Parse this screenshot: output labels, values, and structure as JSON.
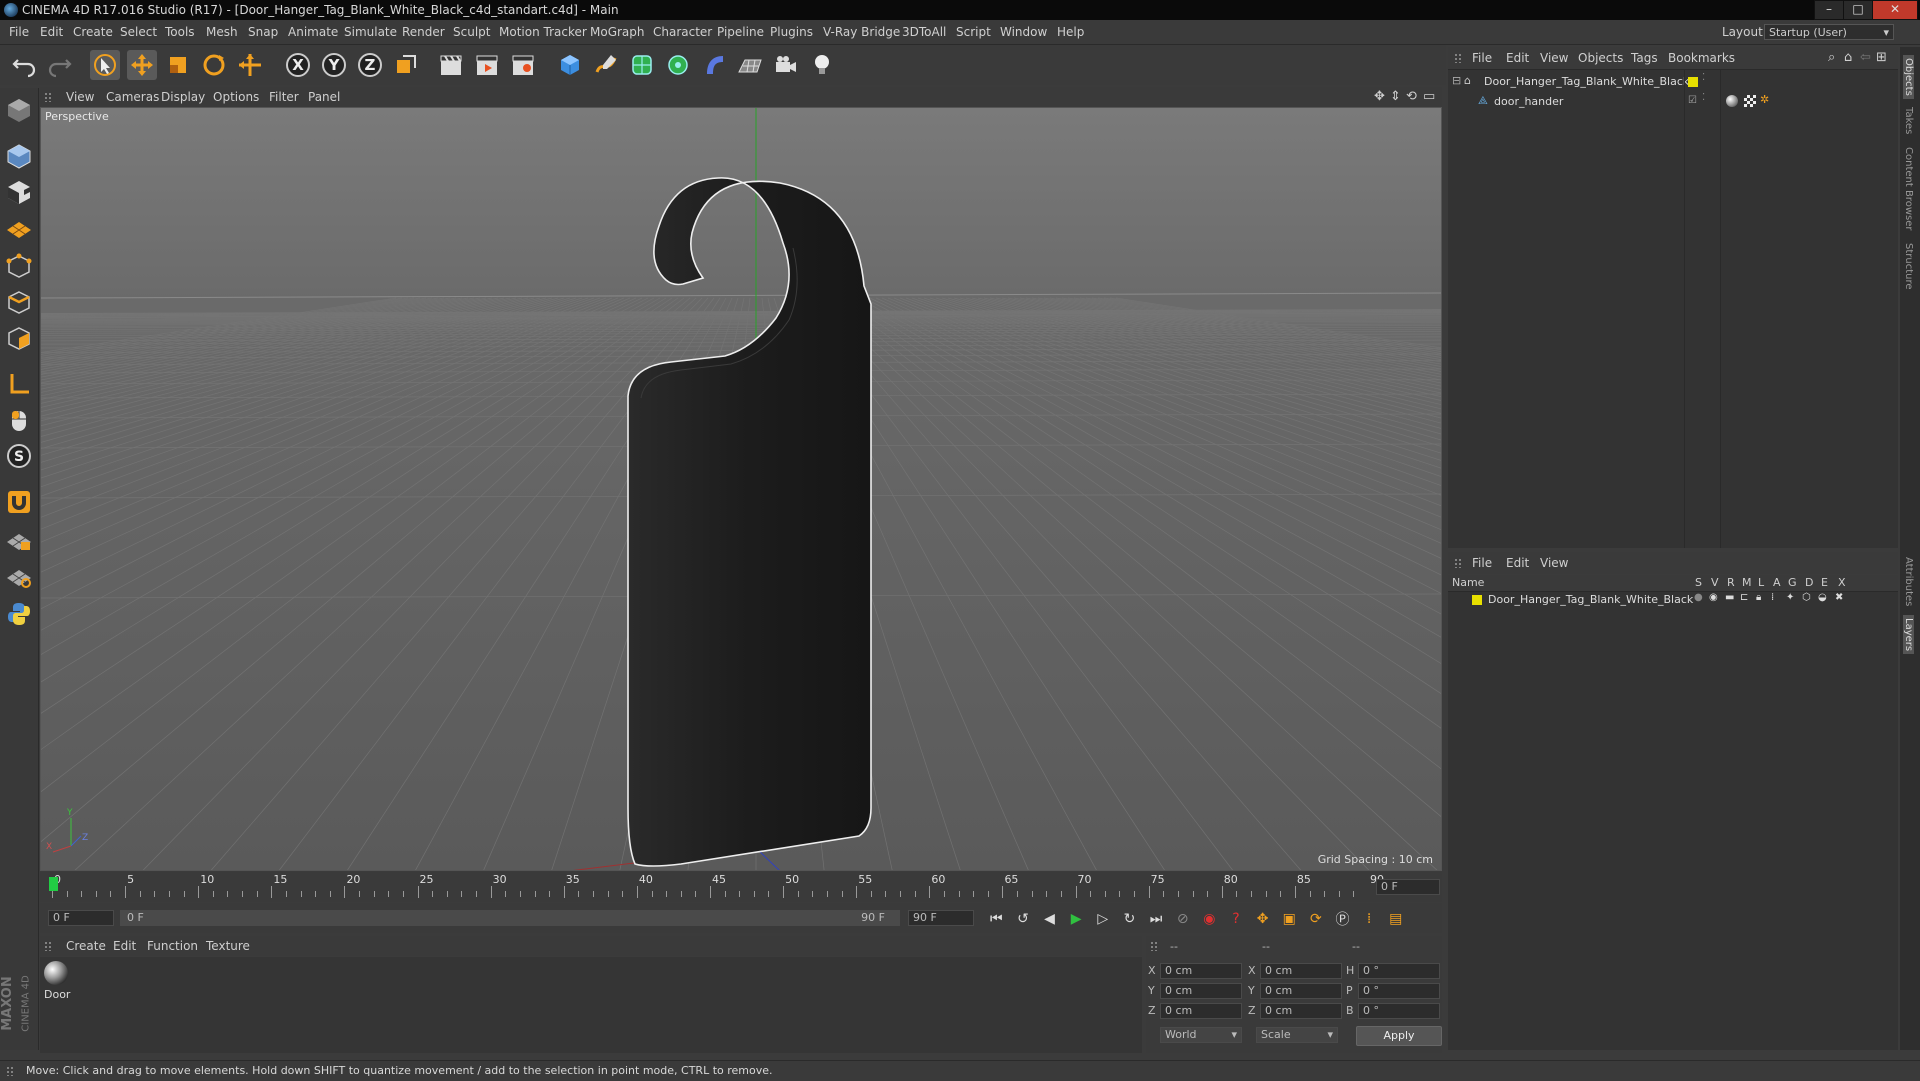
{
  "window": {
    "title": "CINEMA 4D R17.016 Studio (R17) - [Door_Hanger_Tag_Blank_White_Black_c4d_standart.c4d] - Main",
    "min": "–",
    "max": "□",
    "close": "✕"
  },
  "menubar": {
    "items": [
      "File",
      "Edit",
      "Create",
      "Select",
      "Tools",
      "Mesh",
      "Snap",
      "Animate",
      "Simulate",
      "Render",
      "Sculpt",
      "Motion Tracker",
      "MoGraph",
      "Character",
      "Pipeline",
      "Plugins",
      "V-Ray Bridge",
      "3DToAll",
      "Script",
      "Window",
      "Help"
    ],
    "layout_label": "Layout:",
    "layout_value": "Startup (User)"
  },
  "viewport": {
    "menu": [
      "View",
      "Cameras",
      "Display",
      "Options",
      "Filter",
      "Panel"
    ],
    "label": "Perspective",
    "grid_spacing": "Grid Spacing : 10 cm",
    "axis_y": "Y",
    "axis_z": "Z",
    "axis_x": "X"
  },
  "timeline": {
    "ticks": [
      "0",
      "5",
      "10",
      "15",
      "20",
      "25",
      "30",
      "35",
      "40",
      "45",
      "50",
      "55",
      "60",
      "65",
      "70",
      "75",
      "80",
      "85",
      "90"
    ],
    "current_frame_field": "0 F",
    "start_field": "0 F",
    "range_start": "0 F",
    "range_end": "90 F",
    "end_field": "90 F"
  },
  "material_manager": {
    "menu": [
      "Create",
      "Edit",
      "Function",
      "Texture"
    ],
    "materials": [
      {
        "name": "Door"
      }
    ]
  },
  "coordinates": {
    "header": [
      "--",
      "--",
      "--"
    ],
    "rows": [
      {
        "a": "X",
        "av": "0 cm",
        "b": "X",
        "bv": "0 cm",
        "c": "H",
        "cv": "0 °"
      },
      {
        "a": "Y",
        "av": "0 cm",
        "b": "Y",
        "bv": "0 cm",
        "c": "P",
        "cv": "0 °"
      },
      {
        "a": "Z",
        "av": "0 cm",
        "b": "Z",
        "bv": "0 cm",
        "c": "B",
        "cv": "0 °"
      }
    ],
    "mode1": "World",
    "mode2": "Scale",
    "apply": "Apply"
  },
  "object_manager": {
    "menu": [
      "File",
      "Edit",
      "View",
      "Objects",
      "Tags",
      "Bookmarks"
    ],
    "objects": [
      {
        "name": "Door_Hanger_Tag_Blank_White_Black",
        "level": 0
      },
      {
        "name": "door_hander",
        "level": 1
      }
    ]
  },
  "layer_manager": {
    "menu": [
      "File",
      "Edit",
      "View"
    ],
    "columns": [
      "Name",
      "S",
      "V",
      "R",
      "M",
      "L",
      "A",
      "G",
      "D",
      "E",
      "X"
    ],
    "layers": [
      {
        "name": "Door_Hanger_Tag_Blank_White_Black",
        "color": "#e8e000"
      }
    ]
  },
  "side_tabs": {
    "top": [
      "Objects",
      "Takes",
      "Content Browser",
      "Structure"
    ],
    "bottom": [
      "Attributes",
      "Layers"
    ]
  },
  "brand": {
    "maxon": "MAXON",
    "product": "CINEMA 4D"
  },
  "status": "Move: Click and drag to move elements. Hold down SHIFT to quantize movement / add to the selection in point mode, CTRL to remove.",
  "colors": {
    "accent": "#f0a020",
    "layer_yellow": "#e8e000",
    "current_frame": "#22cc44"
  }
}
